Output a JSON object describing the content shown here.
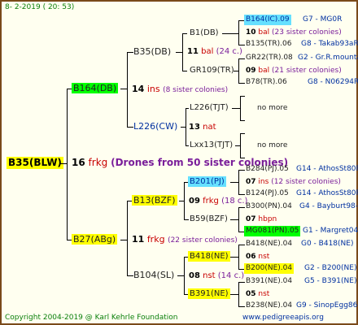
{
  "header": {
    "date_text": "8-  2-2019  ( 20: 53)"
  },
  "footer": {
    "copyright": "Copyright 2004-2019 @ Karl Kehrle Foundation",
    "site": "www.pedigreeapis.org"
  },
  "root": {
    "name": "B35(BLW)"
  },
  "gen1": {
    "sire": {
      "name": "B164(DB)",
      "number": "14",
      "type": "ins",
      "note": "(8 sister colonies)"
    },
    "dam": {
      "name": "B27(ABg)",
      "number": "11",
      "type": "frkg",
      "note": "(22 sister colonies)"
    },
    "root_count": {
      "number": "16",
      "type": "frkg",
      "note": "(Drones from 50 sister colonies)"
    }
  },
  "gen2": {
    "b35": {
      "name": "B35(DB)",
      "number": "11",
      "type": "bal",
      "note": "(24 c.)"
    },
    "l226": {
      "name": "L226(CW)",
      "number": "13",
      "type": "nat"
    },
    "b13": {
      "name": "B13(BZF)",
      "number": "09",
      "type": "frkg",
      "note": "(18 c.)"
    },
    "b104": {
      "name": "B104(SL)",
      "number": "08",
      "type": "nst",
      "note": "(14 c.)"
    }
  },
  "gen3": {
    "b1": {
      "name": "B1(DB)",
      "number": "10",
      "type": "bal",
      "note": "(23 sister colonies)"
    },
    "gr109": {
      "name": "GR109(TR)",
      "number": "09",
      "type": "bal",
      "note": "(21 sister colonies)"
    },
    "l226t": {
      "name": "L226(TJT)",
      "note": "no more"
    },
    "lxx13": {
      "name": "Lxx13(TJT)",
      "note": "no more"
    },
    "b201": {
      "name": "B201(PJ)",
      "number": "07",
      "type": "ins",
      "note": "(12 sister colonies)"
    },
    "b59": {
      "name": "B59(BZF)",
      "number": "07",
      "type": "hbpn"
    },
    "b418": {
      "name": "B418(NE)",
      "number": "06",
      "type": "nst"
    },
    "b391": {
      "name": "B391(NE)",
      "number": "05",
      "type": "nst"
    }
  },
  "gen4": [
    {
      "name": "B164(IC).09",
      "right": "G7 - MG0R"
    },
    {
      "name": "B135(TR).06",
      "right": "G8 - Takab93aR"
    },
    {
      "name": "GR22(TR).08",
      "right": "G2 - Gr.R.mounta"
    },
    {
      "name": "B78(TR).06",
      "right": "G8 - N06294R"
    },
    {
      "name": "B284(PJ).05",
      "right": "G14 - AthosSt80R"
    },
    {
      "name": "B124(PJ).05",
      "right": "G14 - AthosSt80R"
    },
    {
      "name": "B300(PN).04",
      "right": "G4 - Bayburt98-3"
    },
    {
      "name": "MG081(PN).05",
      "right": "G1 - Margret04R"
    },
    {
      "name": "B418(NE).04",
      "right": "G0 - B418(NE)"
    },
    {
      "name": "B200(NE).04",
      "right": "G2 - B200(NE)"
    },
    {
      "name": "B391(NE).04",
      "right": "G5 - B391(NE)"
    },
    {
      "name": "B238(NE).04",
      "right": "G9 - SinopEgg86R"
    }
  ],
  "colors": {
    "yellow": "#ffff00",
    "green": "#00ff00",
    "cyan": "#66e0ff",
    "border": "#7a4a1a"
  }
}
